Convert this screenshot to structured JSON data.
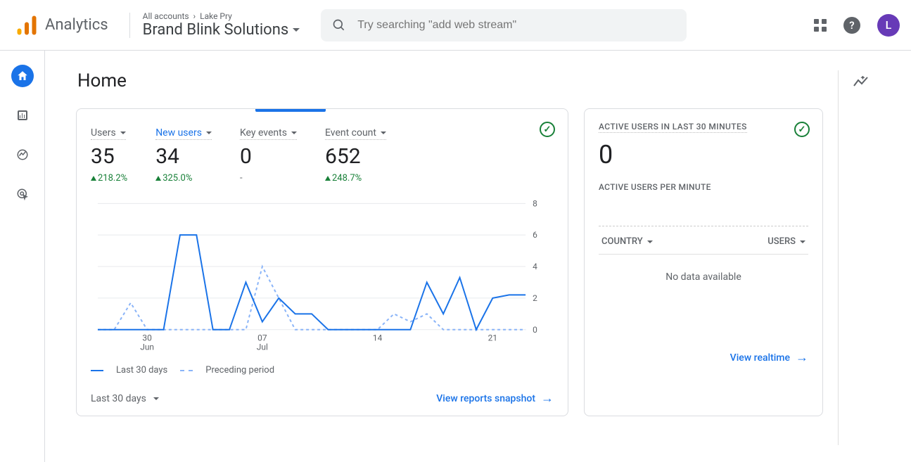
{
  "header": {
    "product": "Analytics",
    "crumb_accounts": "All accounts",
    "crumb_parent": "Lake Pry",
    "property": "Brand Blink Solutions",
    "search_placeholder": "Try searching \"add web stream\"",
    "avatar_initial": "L"
  },
  "page": {
    "title": "Home"
  },
  "main_card": {
    "metrics": [
      {
        "label": "Users",
        "value": "35",
        "delta": "218.2%",
        "has_delta": true,
        "active": false
      },
      {
        "label": "New users",
        "value": "34",
        "delta": "325.0%",
        "has_delta": true,
        "active": true
      },
      {
        "label": "Key events",
        "value": "0",
        "delta": "-",
        "has_delta": false,
        "active": false
      },
      {
        "label": "Event count",
        "value": "652",
        "delta": "248.7%",
        "has_delta": true,
        "active": false
      }
    ],
    "legend_current": "Last 30 days",
    "legend_prev": "Preceding period",
    "period_label": "Last 30 days",
    "footer_link": "View reports snapshot"
  },
  "side_card": {
    "title": "ACTIVE USERS IN LAST 30 MINUTES",
    "value": "0",
    "subtitle": "ACTIVE USERS PER MINUTE",
    "col_country": "COUNTRY",
    "col_users": "USERS",
    "nodata": "No data available",
    "footer_link": "View realtime"
  },
  "chart_data": {
    "type": "line",
    "ylim": [
      0,
      8
    ],
    "yticks": [
      0,
      2,
      4,
      6,
      8
    ],
    "x_tick_labels": [
      "30\nJun",
      "07\nJul",
      "14",
      "21"
    ],
    "series": [
      {
        "name": "Last 30 days",
        "values": [
          0,
          0,
          0,
          0,
          0,
          6,
          6,
          0,
          0,
          3,
          0.5,
          2,
          1,
          1,
          0,
          0,
          0,
          0,
          0,
          0,
          3,
          1,
          3.3,
          0,
          2,
          2.2,
          2.2
        ]
      },
      {
        "name": "Preceding period",
        "values": [
          0,
          0,
          1.7,
          0,
          0,
          0,
          0,
          0,
          0,
          0,
          4,
          2,
          0,
          0,
          0,
          0,
          0,
          0,
          1,
          0.5,
          1,
          0,
          0,
          0,
          0,
          0,
          0
        ]
      }
    ]
  }
}
